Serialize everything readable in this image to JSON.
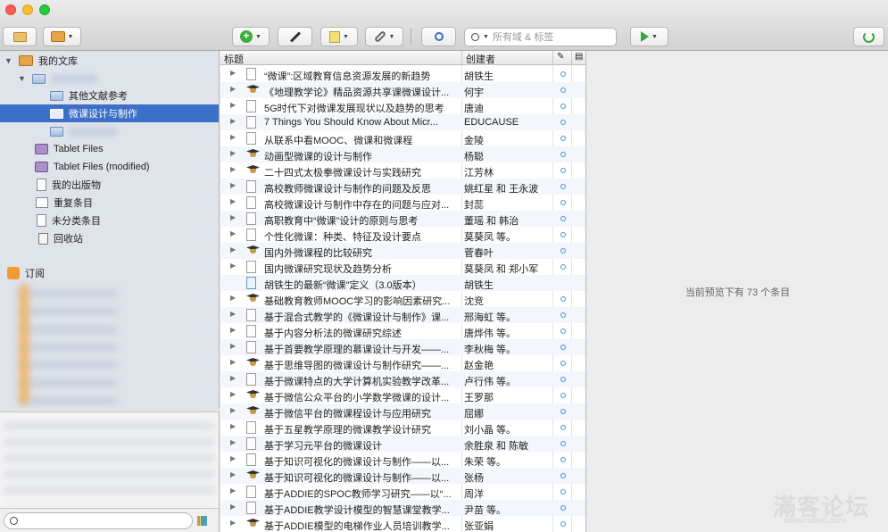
{
  "toolbar": {
    "search_placeholder": "所有域 & 标签"
  },
  "library": {
    "my_library": "我的文库",
    "other_refs": "其他文献参考",
    "selected_collection": "微课设计与制作",
    "tablet_files": "Tablet Files",
    "tablet_files_modified": "Tablet Files (modified)",
    "my_publications": "我的出版物",
    "duplicates": "重复条目",
    "unfiled": "未分类条目",
    "trash": "回收站",
    "feeds": "订阅"
  },
  "list": {
    "col_title": "标题",
    "col_creator": "创建者",
    "items": [
      {
        "type": "paper",
        "title": "“微课”:区域教育信息资源发展的新趋势",
        "creator": "胡铁生",
        "dot": true
      },
      {
        "type": "thesis",
        "title": "《地理教学论》精品资源共享课微课设计...",
        "creator": "何宇",
        "dot": true
      },
      {
        "type": "paper",
        "title": "5G时代下对微课发展现状以及趋势的思考",
        "creator": "唐迪",
        "dot": true
      },
      {
        "type": "paper",
        "title": "7 Things You Should Know About Micr...",
        "creator": "EDUCAUSE",
        "dot": true
      },
      {
        "type": "paper",
        "title": "从联系中看MOOC、微课和微课程",
        "creator": "金陵",
        "dot": true
      },
      {
        "type": "thesis",
        "title": "动画型微课的设计与制作",
        "creator": "杨聪",
        "dot": true
      },
      {
        "type": "thesis",
        "title": "二十四式太极拳微课设计与实践研究",
        "creator": "江芳林",
        "dot": true
      },
      {
        "type": "paper",
        "title": "高校教师微课设计与制作的问题及反思",
        "creator": "姚红星 和 王永波",
        "dot": true
      },
      {
        "type": "paper",
        "title": "高校微课设计与制作中存在的问题与应对...",
        "creator": "封蕊",
        "dot": true
      },
      {
        "type": "paper",
        "title": "高职教育中“微课”设计的原则与思考",
        "creator": "董瑶 和 韩治",
        "dot": true
      },
      {
        "type": "paper",
        "title": "个性化微课：种类、特征及设计要点",
        "creator": "莫葵凤 等。",
        "dot": true
      },
      {
        "type": "thesis",
        "title": "国内外微课程的比较研究",
        "creator": "菅春叶",
        "dot": true
      },
      {
        "type": "paper",
        "title": "国内微课研究现状及趋势分析",
        "creator": "莫葵凤 和 郑小军",
        "dot": true
      },
      {
        "type": "web",
        "title": "胡铁生的最新“微课”定义（3.0版本）",
        "creator": "胡铁生",
        "dot": false
      },
      {
        "type": "thesis",
        "title": "基础教育教师MOOC学习的影响因素研究...",
        "creator": "沈竞",
        "dot": true
      },
      {
        "type": "paper",
        "title": "基于混合式教学的《微课设计与制作》课...",
        "creator": "邢海虹 等。",
        "dot": true
      },
      {
        "type": "paper",
        "title": "基于内容分析法的微课研究综述",
        "creator": "唐烨伟 等。",
        "dot": true
      },
      {
        "type": "paper",
        "title": "基于首要教学原理的慕课设计与开发——...",
        "creator": "李秋梅 等。",
        "dot": true
      },
      {
        "type": "thesis",
        "title": "基于思维导图的微课设计与制作研究——...",
        "creator": "赵金艳",
        "dot": true
      },
      {
        "type": "paper",
        "title": "基于微课特点的大学计算机实验教学改革...",
        "creator": "卢行伟 等。",
        "dot": true
      },
      {
        "type": "thesis",
        "title": "基于微信公众平台的小学数学微课的设计...",
        "creator": "王罗那",
        "dot": true
      },
      {
        "type": "thesis",
        "title": "基于微信平台的微课程设计与应用研究",
        "creator": "屈娜",
        "dot": true
      },
      {
        "type": "paper",
        "title": "基于五星教学原理的微课教学设计研究",
        "creator": "刘小晶 等。",
        "dot": true
      },
      {
        "type": "paper",
        "title": "基于学习元平台的微课设计",
        "creator": "余胜泉 和 陈敏",
        "dot": true
      },
      {
        "type": "paper",
        "title": "基于知识可视化的微课设计与制作——以...",
        "creator": "朱荣 等。",
        "dot": true
      },
      {
        "type": "thesis",
        "title": "基于知识可视化的微课设计与制作——以...",
        "creator": "张杨",
        "dot": true
      },
      {
        "type": "paper",
        "title": "基于ADDIE的SPOC教师学习研究——以“...",
        "creator": "周洋",
        "dot": true
      },
      {
        "type": "paper",
        "title": "基于ADDIE教学设计模型的智慧课堂教学...",
        "creator": "尹苗 等。",
        "dot": true
      },
      {
        "type": "thesis",
        "title": "基于ADDIE模型的电梯作业人员培训教学...",
        "creator": "张亚娟",
        "dot": true
      }
    ]
  },
  "preview": {
    "message": "当前预览下有 73 个条目"
  },
  "watermark": {
    "title": "滿客论坛",
    "url": "www.ruiket.com"
  }
}
